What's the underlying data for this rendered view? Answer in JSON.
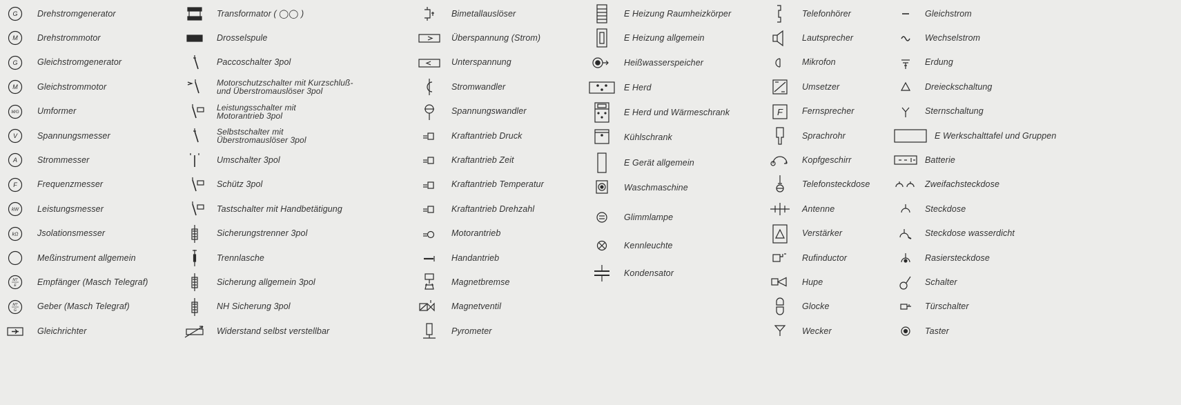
{
  "columns": [
    {
      "id": "col1",
      "items": [
        {
          "label": "Drehstromgenerator",
          "icon": "g-3phase-generator-icon",
          "sym": "circ",
          "txt": "G"
        },
        {
          "label": "Drehstrommotor",
          "icon": "m-3phase-motor-icon",
          "sym": "circ",
          "txt": "M"
        },
        {
          "label": "Gleichstromgenerator",
          "icon": "g-dc-generator-icon",
          "sym": "circ",
          "txt": "G"
        },
        {
          "label": "Gleichstrommotor",
          "icon": "m-dc-motor-icon",
          "sym": "circ",
          "txt": "M"
        },
        {
          "label": "Umformer",
          "icon": "converter-icon",
          "sym": "circ",
          "txt": "M/G"
        },
        {
          "label": "Spannungsmesser",
          "icon": "voltmeter-icon",
          "sym": "circ",
          "txt": "V"
        },
        {
          "label": "Strommesser",
          "icon": "ammeter-icon",
          "sym": "circ",
          "txt": "A"
        },
        {
          "label": "Frequenzmesser",
          "icon": "frequency-meter-icon",
          "sym": "circ",
          "txt": "F"
        },
        {
          "label": "Leistungsmesser",
          "icon": "wattmeter-icon",
          "sym": "circ",
          "txt": "kW"
        },
        {
          "label": "Jsolationsmesser",
          "icon": "insulation-meter-icon",
          "sym": "circ",
          "txt": "kΩ"
        },
        {
          "label": "Meßinstrument allgemein",
          "icon": "measuring-instrument-icon",
          "sym": "circ",
          "txt": ""
        },
        {
          "label": "Empfänger (Masch Telegraf)",
          "icon": "receiver-telegraph-icon",
          "sym": "circ",
          "txt": "MT/E"
        },
        {
          "label": "Geber (Masch Telegraf)",
          "icon": "transmitter-telegraph-icon",
          "sym": "circ",
          "txt": "MT/G"
        },
        {
          "label": "Gleichrichter",
          "icon": "rectifier-icon",
          "sym": "rect",
          "txt": ""
        }
      ]
    },
    {
      "id": "col2",
      "items": [
        {
          "label": "Transformator ( ◯◯ )",
          "icon": "transformer-icon",
          "sym": "transformer"
        },
        {
          "label": "Drosselspule",
          "icon": "choke-coil-icon",
          "sym": "choke"
        },
        {
          "label": "Paccoschalter 3pol",
          "icon": "rotary-switch-icon",
          "sym": "switch"
        },
        {
          "label": "Motorschutzschalter mit Kurzschluß-\nund Überstromauslöser 3pol",
          "icon": "motor-protection-switch-icon",
          "sym": "switch2",
          "two": true
        },
        {
          "label": "Leistungsschalter mit\nMotorantrieb  3pol",
          "icon": "circuit-breaker-icon",
          "sym": "switchm",
          "two": true
        },
        {
          "label": "Selbstschalter mit\nÜberstromauslöser 3pol",
          "icon": "automatic-switch-icon",
          "sym": "switch",
          "two": true
        },
        {
          "label": "Umschalter 3pol",
          "icon": "changeover-switch-icon",
          "sym": "changeover"
        },
        {
          "label": "Schütz  3pol",
          "icon": "contactor-icon",
          "sym": "switchm"
        },
        {
          "label": "Tastschalter mit Handbetätigung",
          "icon": "push-switch-icon",
          "sym": "switchm"
        },
        {
          "label": "Sicherungstrenner 3pol",
          "icon": "fuse-disconnector-icon",
          "sym": "fuse"
        },
        {
          "label": "Trennlasche",
          "icon": "isolating-link-icon",
          "sym": "link"
        },
        {
          "label": "Sicherung  allgemein 3pol",
          "icon": "fuse-icon",
          "sym": "fuse"
        },
        {
          "label": "NH Sicherung 3pol",
          "icon": "nh-fuse-icon",
          "sym": "fuse"
        },
        {
          "label": "Widerstand  selbst  verstellbar",
          "icon": "variable-resistor-icon",
          "sym": "resistor"
        }
      ]
    },
    {
      "id": "col3",
      "items": [
        {
          "label": "Bimetallauslöser",
          "icon": "bimetal-release-icon",
          "sym": "bimetal"
        },
        {
          "label": "Überspannung  (Strom)",
          "icon": "overvoltage-icon",
          "sym": "boxgt"
        },
        {
          "label": "Unterspannung",
          "icon": "undervoltage-icon",
          "sym": "boxlt"
        },
        {
          "label": "Stromwandler",
          "icon": "current-transformer-icon",
          "sym": "ct"
        },
        {
          "label": "Spannungswandler",
          "icon": "voltage-transformer-icon",
          "sym": "vt"
        },
        {
          "label": "Kraftantrieb  Druck",
          "icon": "drive-pressure-icon",
          "sym": "drive"
        },
        {
          "label": "Kraftantrieb  Zeit",
          "icon": "drive-time-icon",
          "sym": "drive"
        },
        {
          "label": "Kraftantrieb  Temperatur",
          "icon": "drive-temperature-icon",
          "sym": "drive"
        },
        {
          "label": "Kraftantrieb  Drehzahl",
          "icon": "drive-speed-icon",
          "sym": "drive"
        },
        {
          "label": "Motorantrieb",
          "icon": "motor-drive-icon",
          "sym": "motordrive"
        },
        {
          "label": "Handantrieb",
          "icon": "hand-drive-icon",
          "sym": "handdrive"
        },
        {
          "label": "Magnetbremse",
          "icon": "magnetic-brake-icon",
          "sym": "brake"
        },
        {
          "label": "Magnetventil",
          "icon": "solenoid-valve-icon",
          "sym": "valve"
        },
        {
          "label": "Pyrometer",
          "icon": "pyrometer-icon",
          "sym": "pyro"
        }
      ]
    },
    {
      "id": "col4",
      "items": [
        {
          "label": "E Heizung  Raumheizkörper",
          "icon": "room-heater-icon",
          "sym": "heater"
        },
        {
          "label": "E Heizung  allgemein",
          "icon": "heating-general-icon",
          "sym": "heatgen"
        },
        {
          "label": "Heißwasserspeicher",
          "icon": "hot-water-tank-icon",
          "sym": "hotwater"
        },
        {
          "label": "E Herd",
          "icon": "electric-stove-icon",
          "sym": "stove"
        },
        {
          "label": "E Herd  und  Wärmeschrank",
          "icon": "stove-warming-cabinet-icon",
          "sym": "stovecab"
        },
        {
          "label": "Kühlschrank",
          "icon": "refrigerator-icon",
          "sym": "fridge"
        },
        {
          "label": "E Gerät  allgemein",
          "icon": "appliance-general-icon",
          "sym": "appliance"
        },
        {
          "label": "Waschmaschine",
          "icon": "washing-machine-icon",
          "sym": "washer"
        },
        {
          "label": "Glimmlampe",
          "icon": "glow-lamp-icon",
          "sym": "glow"
        },
        {
          "label": "Kennleuchte",
          "icon": "indicator-light-icon",
          "sym": "lamp"
        },
        {
          "label": "Kondensator",
          "icon": "capacitor-icon",
          "sym": "capacitor"
        }
      ]
    },
    {
      "id": "col5",
      "items": [
        {
          "label": "Telefonhörer",
          "icon": "telephone-receiver-icon",
          "sym": "handset"
        },
        {
          "label": "Lautsprecher",
          "icon": "loudspeaker-icon",
          "sym": "speaker"
        },
        {
          "label": "Mikrofon",
          "icon": "microphone-icon",
          "sym": "mic"
        },
        {
          "label": "Umsetzer",
          "icon": "converter-box-icon",
          "sym": "umsetzer"
        },
        {
          "label": "Fernsprecher",
          "icon": "telephone-icon",
          "sym": "phonebox"
        },
        {
          "label": "Sprachrohr",
          "icon": "speaking-tube-icon",
          "sym": "tube"
        },
        {
          "label": "Kopfgeschirr",
          "icon": "headset-icon",
          "sym": "headset"
        },
        {
          "label": "Telefonsteckdose",
          "icon": "telephone-socket-icon",
          "sym": "telsocket"
        },
        {
          "label": "Antenne",
          "icon": "antenna-icon",
          "sym": "antenna"
        },
        {
          "label": "Verstärker",
          "icon": "amplifier-icon",
          "sym": "amplifier"
        },
        {
          "label": "Rufinductor",
          "icon": "call-inductor-icon",
          "sym": "inductor"
        },
        {
          "label": "Hupe",
          "icon": "horn-icon",
          "sym": "horn"
        },
        {
          "label": "Glocke",
          "icon": "bell-icon",
          "sym": "bell"
        },
        {
          "label": "Wecker",
          "icon": "buzzer-icon",
          "sym": "wecker"
        }
      ]
    },
    {
      "id": "col6",
      "items": [
        {
          "label": "Gleichstrom",
          "icon": "direct-current-icon",
          "sym": "dc"
        },
        {
          "label": "Wechselstrom",
          "icon": "alternating-current-icon",
          "sym": "ac"
        },
        {
          "label": "Erdung",
          "icon": "earth-icon",
          "sym": "earth"
        },
        {
          "label": "Dreieckschaltung",
          "icon": "delta-connection-icon",
          "sym": "delta"
        },
        {
          "label": "Sternschaltung",
          "icon": "star-connection-icon",
          "sym": "star"
        },
        {
          "label": "E Werkschalttafel  und  Gruppen",
          "icon": "switchboard-icon",
          "sym": "board"
        },
        {
          "label": "Batterie",
          "icon": "battery-icon",
          "sym": "battery"
        },
        {
          "label": "Zweifachsteckdose",
          "icon": "double-socket-icon",
          "sym": "dsocket"
        },
        {
          "label": "Steckdose",
          "icon": "socket-icon",
          "sym": "socket"
        },
        {
          "label": "Steckdose wasserdicht",
          "icon": "waterproof-socket-icon",
          "sym": "wsocket"
        },
        {
          "label": "Rasiersteckdose",
          "icon": "shaver-socket-icon",
          "sym": "rsocket"
        },
        {
          "label": "Schalter",
          "icon": "switch-icon",
          "sym": "schalter"
        },
        {
          "label": "Türschalter",
          "icon": "door-switch-icon",
          "sym": "door"
        },
        {
          "label": "Taster",
          "icon": "push-button-icon",
          "sym": "taster"
        }
      ]
    }
  ]
}
